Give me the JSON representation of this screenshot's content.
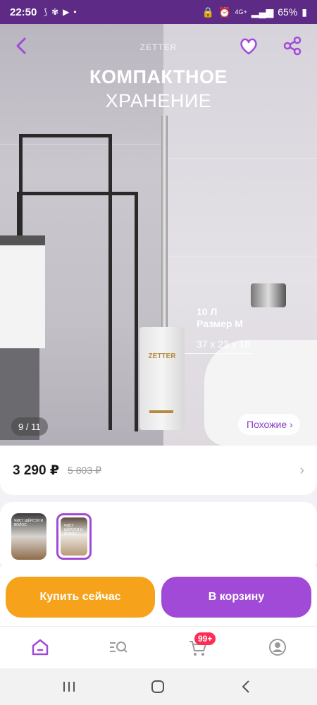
{
  "status_bar": {
    "time": "22:50",
    "battery": "65%",
    "network": "4G+"
  },
  "hero": {
    "brand_watermark": "ZETTER",
    "headline_bold": "КОМПАКТНОЕ",
    "headline_regular": "ХРАНЕНИЕ",
    "spec_volume": "10 Л",
    "spec_size": "Размер М",
    "spec_dimensions": "37 x 23 x 18",
    "bucket_brand": "ZETTER",
    "counter": "9 / 11",
    "similar_label": "Похожие ›",
    "icons": [
      "back-arrow-icon",
      "heart-icon",
      "share-icon"
    ]
  },
  "price_card": {
    "price": "3 290 ₽",
    "old_price": "5 803 ₽",
    "chevron": "›"
  },
  "thumbnails": [
    {
      "caption": "ЧИСТ ШЁРСТИ И ВОЛОС",
      "selected": false
    },
    {
      "caption": "ЧИСТ ШЁРСТИ И ВОЛОС",
      "selected": true
    }
  ],
  "actions": {
    "buy_now": "Купить сейчас",
    "add_to_cart": "В корзину"
  },
  "bottom_nav": {
    "cart_badge": "99+",
    "items": [
      "home-icon",
      "catalog-search-icon",
      "cart-icon",
      "profile-icon"
    ]
  },
  "colors": {
    "accent_purple": "#a24ad8",
    "accent_orange": "#f7a21b",
    "status_bar": "#5d2a86",
    "badge_red": "#ff2d55"
  }
}
